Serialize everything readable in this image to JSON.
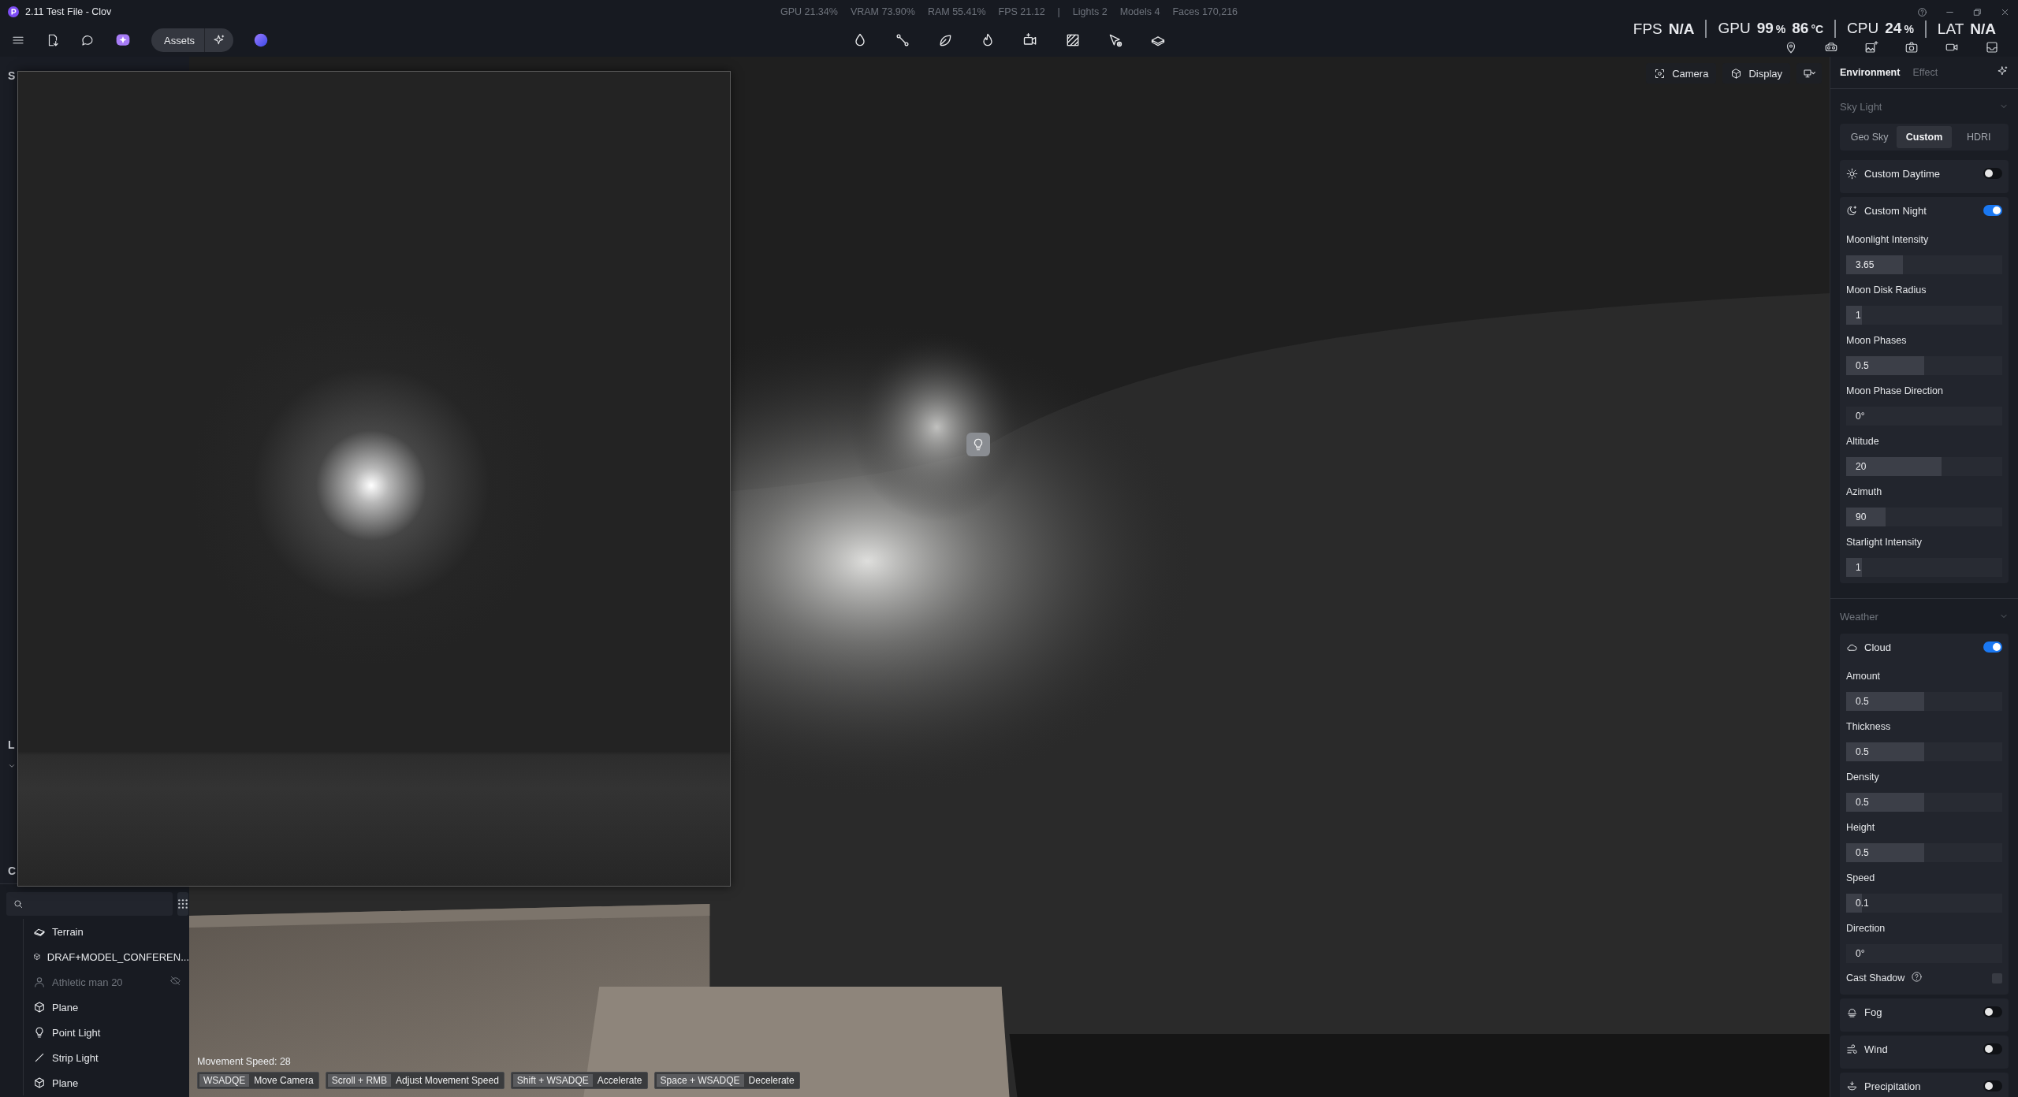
{
  "title_bar": {
    "title": "2.11 Test File - Clov",
    "stats": [
      "GPU 21.34%",
      "VRAM 73.90%",
      "RAM 55.41%",
      "FPS 21.12",
      "|",
      "Lights 2",
      "Models 4",
      "Faces 170,216"
    ]
  },
  "toolbar": {
    "assets_button": "Assets"
  },
  "performance": [
    {
      "label": "FPS",
      "parts": [
        {
          "value": "N/A"
        }
      ]
    },
    {
      "label": "GPU",
      "parts": [
        {
          "value": "99",
          "unit": "%"
        },
        {
          "value": "86",
          "unit": "°C"
        }
      ]
    },
    {
      "label": "CPU",
      "parts": [
        {
          "value": "24",
          "unit": "%"
        }
      ]
    },
    {
      "label": "LAT",
      "parts": [
        {
          "value": "N/A"
        }
      ]
    }
  ],
  "left_panel": {
    "section_labels": [
      "S",
      "L",
      "C"
    ]
  },
  "scene_tree": {
    "items": [
      {
        "kind": "terrain",
        "label": "Terrain",
        "hidden": false
      },
      {
        "kind": "mesh",
        "label": "DRAF+MODEL_CONFEREN...",
        "hidden": false
      },
      {
        "kind": "person",
        "label": "Athletic man 20",
        "hidden": true
      },
      {
        "kind": "mesh",
        "label": "Plane",
        "hidden": false
      },
      {
        "kind": "point_light",
        "label": "Point Light",
        "hidden": false
      },
      {
        "kind": "strip_light",
        "label": "Strip Light",
        "hidden": false
      },
      {
        "kind": "mesh",
        "label": "Plane",
        "hidden": false
      }
    ]
  },
  "viewport": {
    "buttons": [
      {
        "kind": "camera",
        "label": "Camera"
      },
      {
        "kind": "display",
        "label": "Display"
      }
    ],
    "movement_speed": "Movement Speed: 28",
    "shortcuts": [
      {
        "keys": "WSADQE",
        "action": "Move Camera"
      },
      {
        "keys": "Scroll + RMB",
        "action": "Adjust Movement Speed"
      },
      {
        "keys": "Shift + WSADQE",
        "action": "Accelerate"
      },
      {
        "keys": "Space + WSADQE",
        "action": "Decelerate"
      }
    ]
  },
  "right_panel": {
    "tabs": [
      {
        "label": "Environment",
        "selected": true
      },
      {
        "label": "Effect",
        "selected": false
      }
    ],
    "sections": [
      {
        "title": "Sky Light",
        "modes": [
          {
            "label": "Geo Sky",
            "selected": false
          },
          {
            "label": "Custom",
            "selected": true
          },
          {
            "label": "HDRI",
            "selected": false
          }
        ],
        "groups": [
          {
            "kind": "daytime",
            "label": "Custom Daytime",
            "on": false
          },
          {
            "kind": "night",
            "label": "Custom Night",
            "on": true,
            "controls": [
              {
                "kind": "slider",
                "label": "Moonlight Intensity",
                "value": "3.65",
                "level": 0.365
              },
              {
                "kind": "slider",
                "label": "Moon Disk Radius",
                "value": "1",
                "level": 0.1
              },
              {
                "kind": "slider",
                "label": "Moon Phases",
                "value": "0.5",
                "level": 0.5
              },
              {
                "kind": "number",
                "label": "Moon Phase Direction",
                "value": "0°"
              },
              {
                "kind": "slider",
                "label": "Altitude",
                "value": "20",
                "level": 0.61
              },
              {
                "kind": "slider",
                "label": "Azimuth",
                "value": "90",
                "level": 0.25
              },
              {
                "kind": "slider",
                "label": "Starlight Intensity",
                "value": "1",
                "level": 0.1
              }
            ]
          }
        ]
      },
      {
        "title": "Weather",
        "groups": [
          {
            "kind": "cloud",
            "label": "Cloud",
            "on": true,
            "controls": [
              {
                "kind": "slider",
                "label": "Amount",
                "value": "0.5",
                "level": 0.5
              },
              {
                "kind": "slider",
                "label": "Thickness",
                "value": "0.5",
                "level": 0.5
              },
              {
                "kind": "slider",
                "label": "Density",
                "value": "0.5",
                "level": 0.5
              },
              {
                "kind": "slider",
                "label": "Height",
                "value": "0.5",
                "level": 0.5
              },
              {
                "kind": "slider",
                "label": "Speed",
                "value": "0.1",
                "level": 0.1
              },
              {
                "kind": "number",
                "label": "Direction",
                "value": "0°"
              },
              {
                "kind": "checkbox",
                "label": "Cast Shadow",
                "checked": false
              }
            ]
          },
          {
            "kind": "fog",
            "label": "Fog",
            "on": false
          },
          {
            "kind": "wind",
            "label": "Wind",
            "on": false
          },
          {
            "kind": "precipitation",
            "label": "Precipitation",
            "on": false
          }
        ]
      }
    ]
  }
}
